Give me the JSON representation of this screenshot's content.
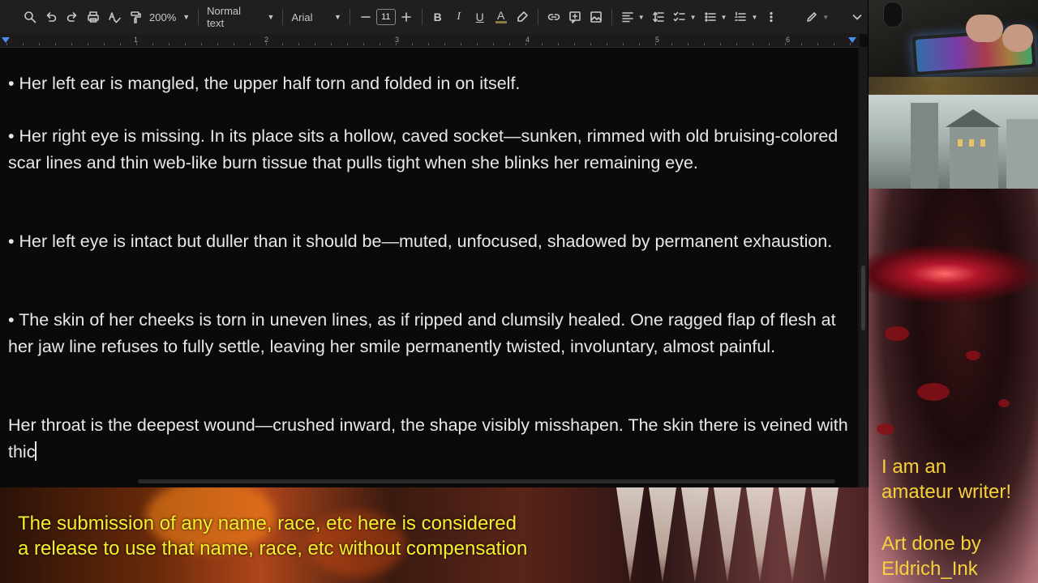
{
  "toolbar": {
    "zoom": "200%",
    "style": "Normal text",
    "font": "Arial",
    "font_size": "11",
    "bold_label": "B",
    "italic_label": "I",
    "underline_label": "U",
    "text_color_label": "A",
    "icons": [
      "search-icon",
      "undo-icon",
      "redo-icon",
      "print-icon",
      "spellcheck-icon",
      "paint-format-icon",
      "link-icon",
      "comment-icon",
      "image-icon",
      "align-icon",
      "line-spacing-icon",
      "checklist-icon",
      "bullet-list-icon",
      "numbered-list-icon",
      "more-icon",
      "editing-mode-icon",
      "collapse-icon"
    ]
  },
  "ruler": {
    "numbers": [
      "1",
      "2",
      "3",
      "4",
      "5",
      "6"
    ]
  },
  "document": {
    "paragraphs": [
      "• Her left ear is mangled, the upper half torn and folded in on itself.",
      "• Her right eye is missing. In its place sits a hollow, caved socket—sunken, rimmed with old bruising-colored scar lines and thin web-like burn tissue that pulls tight when she blinks her remaining eye.",
      "• Her left eye is intact but duller than it should be—muted, unfocused, shadowed by permanent exhaustion.",
      "• The skin of her cheeks is torn in uneven lines, as if ripped and clumsily healed. One ragged flap of flesh at her jaw line refuses to fully settle, leaving her smile permanently twisted, involuntary, almost painful.",
      "Her throat is the deepest wound—crushed inward, the shape visibly misshapen. The skin there is veined with thic"
    ]
  },
  "overlay": {
    "side_note_line1": "I am an",
    "side_note_line2": "amateur writer!",
    "credit_line1": "Art done by",
    "credit_line2": "Eldrich_Ink",
    "disclaimer_line1": "The submission of any name, race, etc here is considered",
    "disclaimer_line2": "a release to use that name, race, etc without compensation",
    "text_color": "#f5d23a"
  }
}
